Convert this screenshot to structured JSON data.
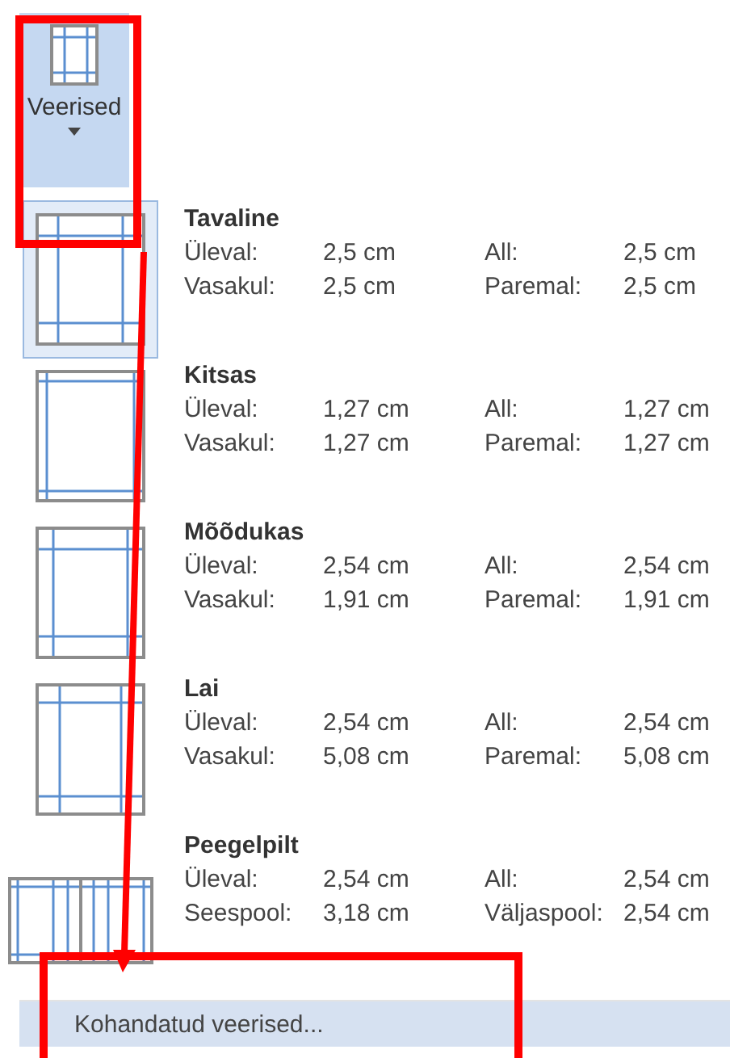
{
  "ribbon_button": {
    "label": "Veerised",
    "selected": true
  },
  "presets": [
    {
      "name": "Tavaline",
      "kind": "normal",
      "selected": true,
      "rows": [
        [
          "Üleval:",
          "2,5 cm",
          "All:",
          "2,5 cm"
        ],
        [
          "Vasakul:",
          "2,5 cm",
          "Paremal:",
          "2,5 cm"
        ]
      ]
    },
    {
      "name": "Kitsas",
      "kind": "narrow",
      "selected": false,
      "rows": [
        [
          "Üleval:",
          "1,27 cm",
          "All:",
          "1,27 cm"
        ],
        [
          "Vasakul:",
          "1,27 cm",
          "Paremal:",
          "1,27 cm"
        ]
      ]
    },
    {
      "name": "Mõõdukas",
      "kind": "moderate",
      "selected": false,
      "rows": [
        [
          "Üleval:",
          "2,54 cm",
          "All:",
          "2,54 cm"
        ],
        [
          "Vasakul:",
          "1,91 cm",
          "Paremal:",
          "1,91 cm"
        ]
      ]
    },
    {
      "name": "Lai",
      "kind": "wide",
      "selected": false,
      "rows": [
        [
          "Üleval:",
          "2,54 cm",
          "All:",
          "2,54 cm"
        ],
        [
          "Vasakul:",
          "5,08 cm",
          "Paremal:",
          "5,08 cm"
        ]
      ]
    },
    {
      "name": "Peegelpilt",
      "kind": "mirrored",
      "selected": false,
      "rows": [
        [
          "Üleval:",
          "2,54 cm",
          "All:",
          "2,54 cm"
        ],
        [
          "Seespool:",
          "3,18 cm",
          "Väljaspool:",
          "2,54 cm"
        ]
      ]
    }
  ],
  "custom_item": {
    "label": "Kohandatud veerised..."
  }
}
